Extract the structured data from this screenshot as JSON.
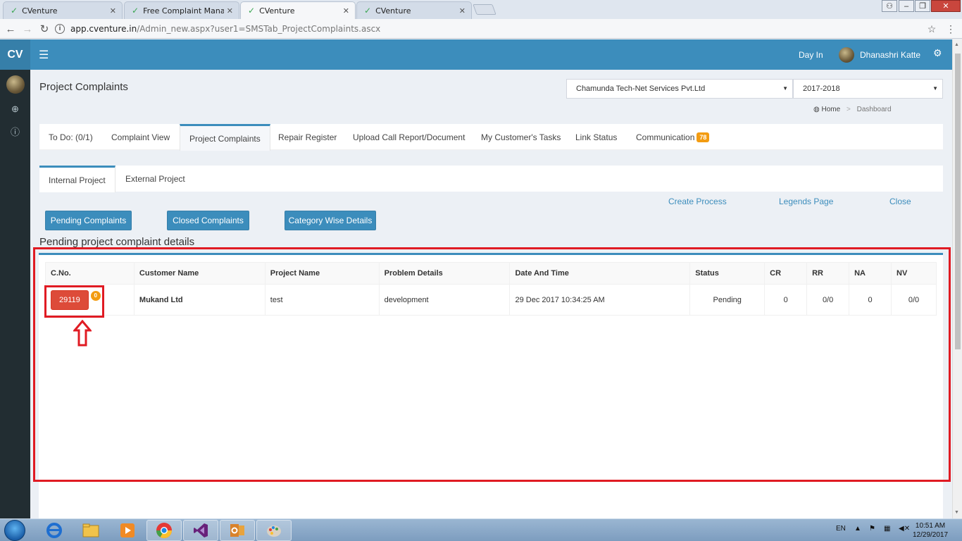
{
  "browser": {
    "tabs": [
      {
        "title": "CVenture",
        "active": false
      },
      {
        "title": "Free Complaint Manager",
        "active": false
      },
      {
        "title": "CVenture",
        "active": true
      },
      {
        "title": "CVenture",
        "active": false
      }
    ],
    "url_host": "app.cventure.in",
    "url_path": "/Admin_new.aspx?user1=SMSTab_ProjectComplaints.ascx"
  },
  "app": {
    "logo": "CV",
    "day_in": "Day In",
    "user_name": "Dhanashri Katte"
  },
  "page": {
    "title": "Project Complaints",
    "company_select": "Chamunda Tech-Net Services Pvt.Ltd",
    "year_select": "2017-2018",
    "breadcrumb_home": "Home",
    "breadcrumb_current": "Dashboard"
  },
  "main_tabs": [
    {
      "label": "To Do: (0/1)"
    },
    {
      "label": "Complaint View"
    },
    {
      "label": "Project Complaints"
    },
    {
      "label": "Repair Register"
    },
    {
      "label": "Upload Call Report/Document"
    },
    {
      "label": "My Customer's Tasks"
    },
    {
      "label": "Link Status"
    },
    {
      "label": "Communication",
      "badge": "78"
    }
  ],
  "sub_tabs": [
    {
      "label": "Internal Project"
    },
    {
      "label": "External Project"
    }
  ],
  "links": {
    "create_process": "Create Process",
    "legends_page": "Legends Page",
    "close": "Close"
  },
  "buttons": {
    "pending": "Pending Complaints",
    "closed": "Closed Complaints",
    "category": "Category Wise Details"
  },
  "section_title": "Pending project complaint details",
  "table": {
    "headers": [
      "C.No.",
      "Customer Name",
      "Project Name",
      "Problem Details",
      "Date And Time",
      "Status",
      "CR",
      "RR",
      "NA",
      "NV"
    ],
    "rows": [
      {
        "cno": "29119",
        "cno_badge": "0",
        "customer": "Mukand Ltd",
        "project": "test",
        "problem": "development",
        "datetime": "29 Dec 2017 10:34:25 AM",
        "status": "Pending",
        "cr": "0",
        "rr": "0/0",
        "na": "0",
        "nv": "0/0"
      }
    ]
  },
  "taskbar": {
    "lang": "EN",
    "time": "10:51 AM",
    "date": "12/29/2017"
  },
  "colors": {
    "header_blue": "#3c8dbc",
    "sidebar_dark": "#222d32",
    "danger_red": "#dd4b39",
    "badge_orange": "#f39c12",
    "highlight_red": "#e01b23"
  }
}
